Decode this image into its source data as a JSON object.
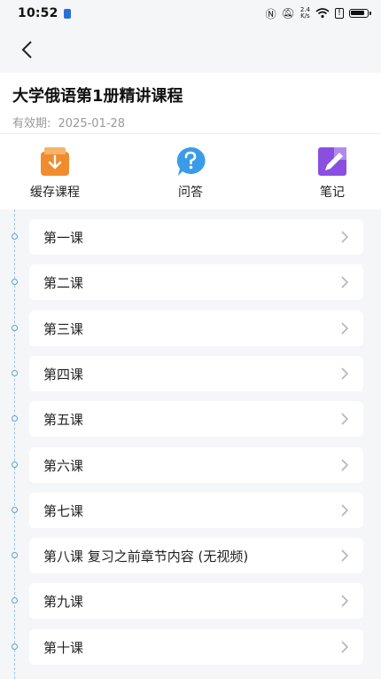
{
  "status_bar": {
    "time": "10:52",
    "net_speed_top": "2.4",
    "net_speed_bottom": "K/s"
  },
  "course": {
    "title": "大学俄语第1册精讲课程",
    "validity_label": "有效期:",
    "validity_date": "2025-01-28"
  },
  "actions": [
    {
      "label": "缓存课程",
      "icon": "download-icon",
      "color": "#f08c2e"
    },
    {
      "label": "问答",
      "icon": "question-icon",
      "color": "#3a9be9"
    },
    {
      "label": "笔记",
      "icon": "note-pen-icon",
      "color": "#8a4fe0"
    }
  ],
  "lessons": [
    "第一课",
    "第二课",
    "第三课",
    "第四课",
    "第五课",
    "第六课",
    "第七课",
    "第八课  复习之前章节内容  (无视频)",
    "第九课",
    "第十课"
  ],
  "colors": {
    "timeline": "#9cc6ea",
    "dot": "#5aa2e0",
    "background": "#f5f6f7"
  }
}
